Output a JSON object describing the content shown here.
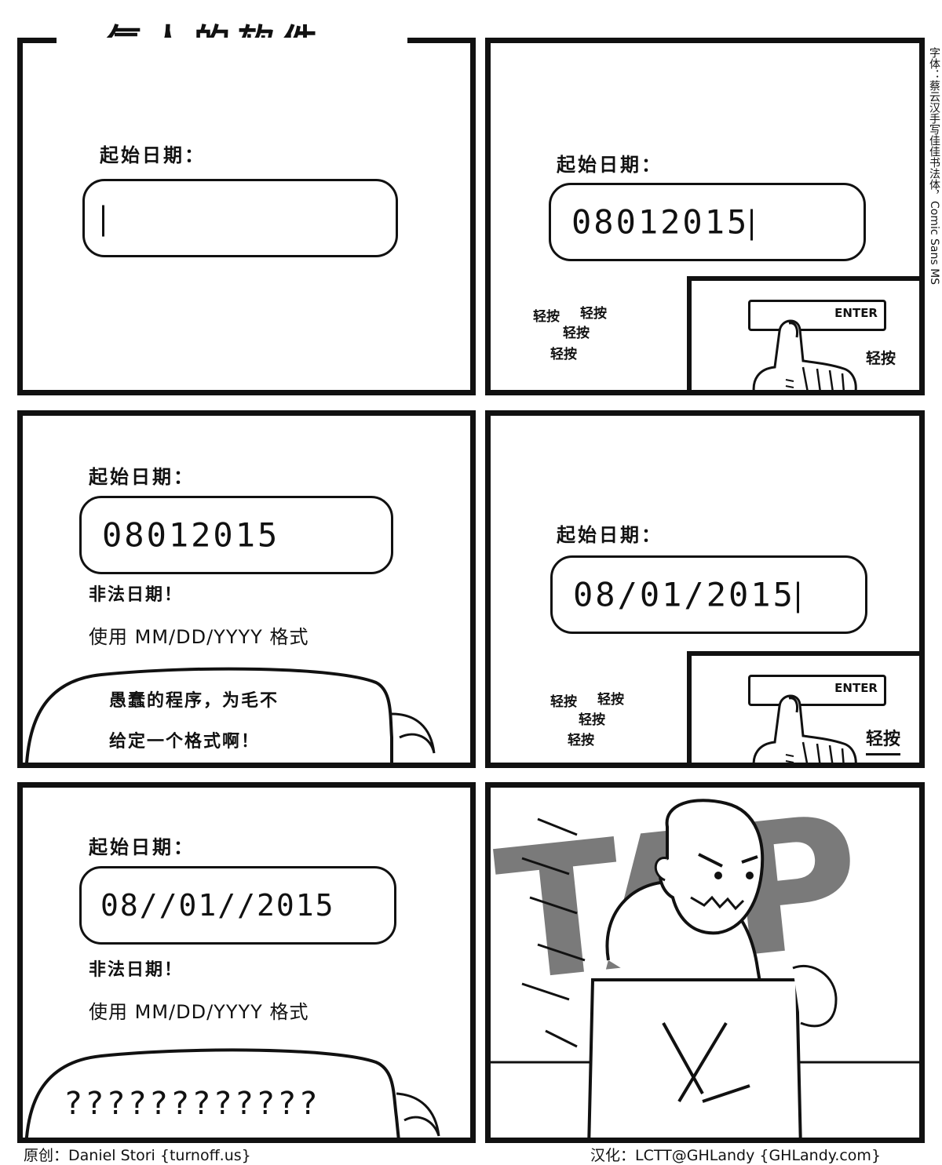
{
  "title": "气人的软件",
  "side_note": "字体：蔡云汉手写佳佳书法体，Comic Sans MS",
  "panels": {
    "p1": {
      "label": "起始日期：",
      "value": ""
    },
    "p2": {
      "label": "起始日期：",
      "value": "08012015",
      "taps": [
        "轻按",
        "轻按",
        "轻按",
        "轻按"
      ],
      "tap_near_key": "轻按",
      "enter_key": "ENTER"
    },
    "p3": {
      "label": "起始日期：",
      "value": "08012015",
      "error": "非法日期！",
      "hint": "使用 MM/DD/YYYY 格式",
      "bubble": [
        "愚蠢的程序，为毛不",
        "给定一个格式啊！"
      ]
    },
    "p4": {
      "label": "起始日期：",
      "value": "08/01/2015",
      "taps": [
        "轻按",
        "轻按",
        "轻按",
        "轻按"
      ],
      "tap_near_key": "轻按",
      "enter_key": "ENTER"
    },
    "p5": {
      "label": "起始日期：",
      "value": "08//01//2015",
      "error": "非法日期！",
      "hint": "使用 MM/DD/YYYY 格式",
      "bubble": "????????????"
    },
    "p6": {
      "sound": "TAP"
    }
  },
  "credits": {
    "original": "原创：Daniel Stori {turnoff.us}",
    "translation": "汉化：LCTT@GHLandy {GHLandy.com}"
  }
}
